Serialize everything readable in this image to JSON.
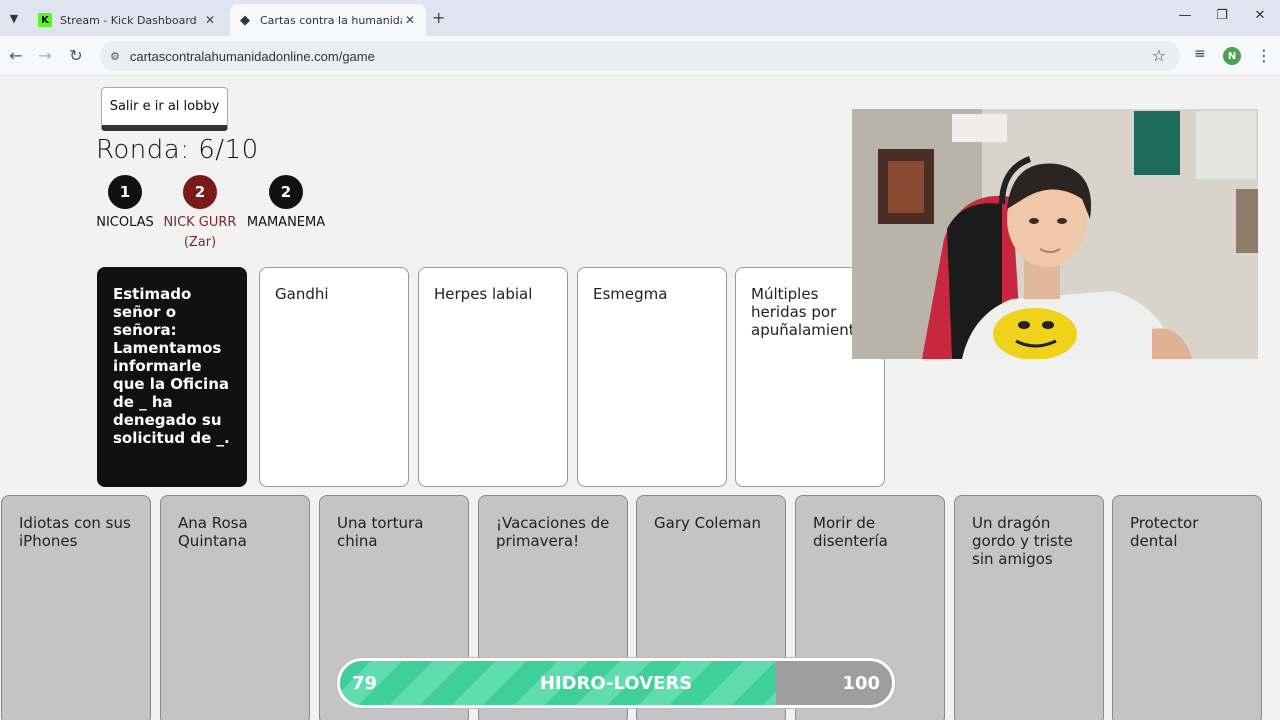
{
  "browser": {
    "tabs": [
      {
        "title": "Stream - Kick Dashboard",
        "favicon": "kick-icon",
        "active": false
      },
      {
        "title": "Cartas contra la humanidad onl",
        "favicon": "card-icon",
        "active": true
      }
    ],
    "url": "cartascontralahumanidadonline.com/game",
    "profile_initial": "N"
  },
  "game": {
    "lobby_button": "Salir e ir al lobby",
    "round_label": "Ronda: 6/10",
    "players": [
      {
        "score": "1",
        "name": "NICOLAS",
        "role": ""
      },
      {
        "score": "2",
        "name": "NICK GURR",
        "role": "(Zar)"
      },
      {
        "score": "2",
        "name": "MAMANEMA",
        "role": ""
      }
    ],
    "black_card": "Estimado señor o señora: Lamentamos informarle que la Oficina de _ ha denegado su solicitud de _.",
    "played_cards": [
      "Gandhi",
      "Herpes labial",
      "Esmegma",
      "Múltiples heridas por apuñalamiento"
    ],
    "hand_cards": [
      "Idiotas con sus iPhones",
      "Ana Rosa Quintana",
      "Una tortura china",
      "¡Vacaciones de primavera!",
      "Gary Coleman",
      "Morir de disentería",
      "Un dragón gordo y triste sin amigos",
      "Protector dental"
    ]
  },
  "goal_bar": {
    "current": "79",
    "title": "HIDRO-LOVERS",
    "max": "100",
    "progress_fraction": 0.79,
    "fill_color": "#3fcf9a"
  }
}
